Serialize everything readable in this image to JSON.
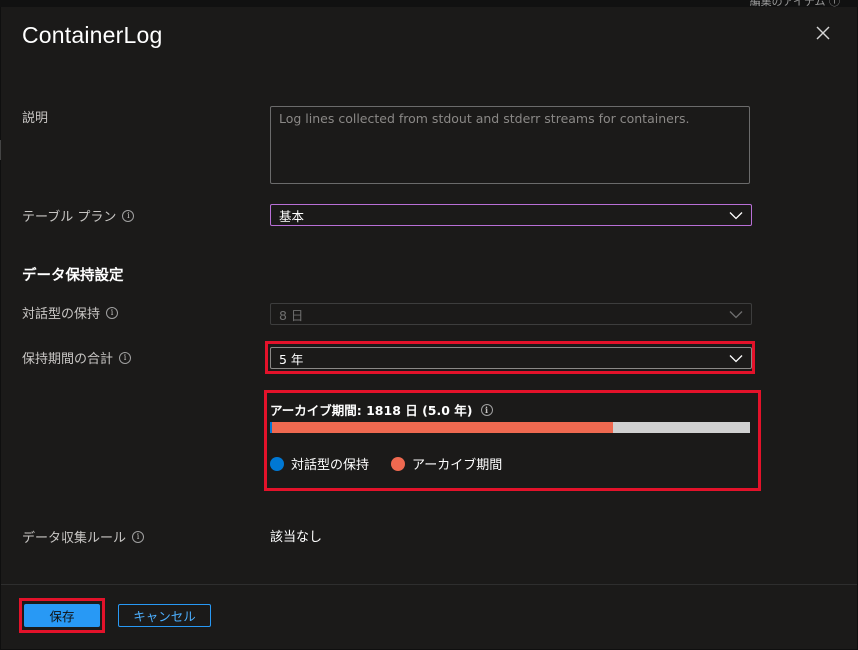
{
  "topstrip": {
    "text": "編集のアイテム ⓘ"
  },
  "panel": {
    "title": "ContainerLog",
    "close_label": "×"
  },
  "description": {
    "label": "説明",
    "value": "Log lines collected from stdout and stderr streams for containers."
  },
  "table_plan": {
    "label": "テーブル プラン",
    "value": "基本"
  },
  "retention": {
    "heading": "データ保持設定",
    "interactive_label": "対話型の保持",
    "interactive_value": "8 日",
    "total_label": "保持期間の合計",
    "total_value": "5 年"
  },
  "archive": {
    "title": "アーカイブ期間: 1818 日 (5.0 年)",
    "interactive_days": 8,
    "archive_days": 1818,
    "interactive_fraction": 0.004,
    "archive_fraction": 0.71,
    "legend": {
      "interactive": "対話型の保持",
      "archive": "アーカイブ期間"
    },
    "colors": {
      "interactive": "#0078d4",
      "archive": "#ef6950",
      "track": "#d0d0d0"
    }
  },
  "dcr": {
    "label": "データ収集ルール",
    "value": "該当なし"
  },
  "footer": {
    "save_label": "保存",
    "cancel_label": "キャンセル"
  },
  "colors": {
    "highlight": "#e3122a",
    "primary": "#2899f5",
    "panel_bg": "#1b1a19"
  }
}
